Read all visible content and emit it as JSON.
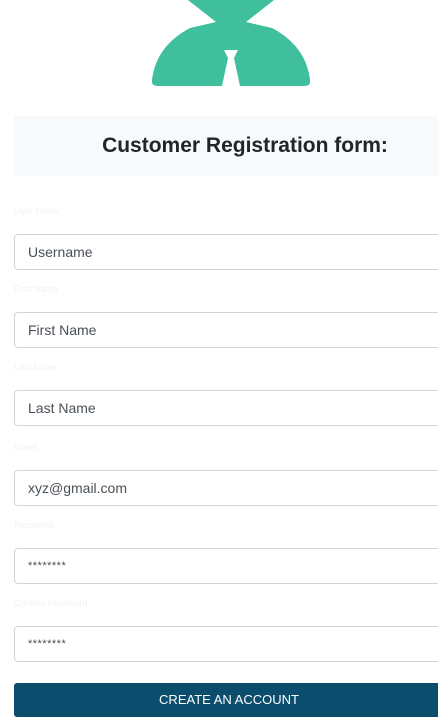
{
  "brand": {
    "logo_icon": "person-with-tie-icon",
    "logo_color": "#3fbf9b"
  },
  "form": {
    "title": "Customer Registration form:",
    "fields": [
      {
        "label": "User Name",
        "placeholder": "Username",
        "value": ""
      },
      {
        "label": "First Name",
        "placeholder": "First Name",
        "value": ""
      },
      {
        "label": "Last Name",
        "placeholder": "Last Name",
        "value": ""
      },
      {
        "label": "Email",
        "placeholder": "",
        "value": "xyz@gmail.com"
      },
      {
        "label": "Password",
        "placeholder": "",
        "value": "********"
      },
      {
        "label": "Confirm Password",
        "placeholder": "",
        "value": "********"
      }
    ],
    "submit_label": "CREATE AN ACCOUNT",
    "submit_color": "#0b4d6d"
  }
}
